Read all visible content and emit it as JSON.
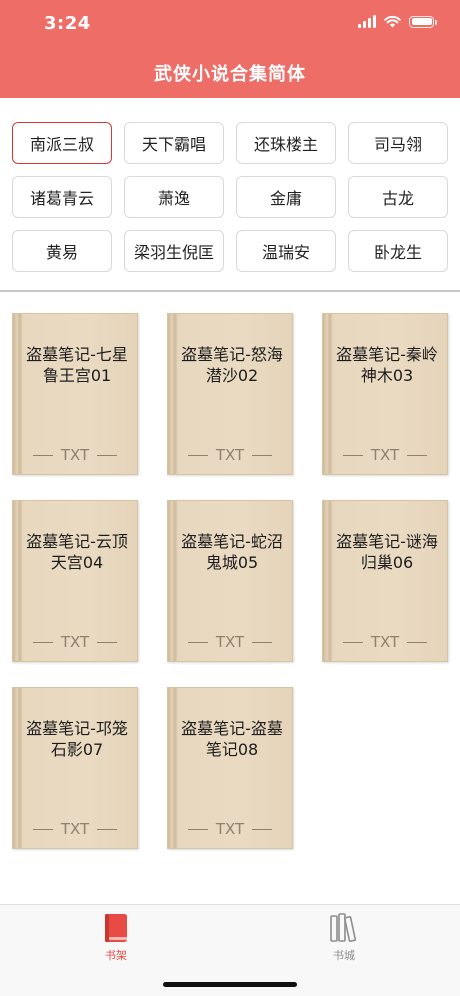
{
  "status_bar": {
    "time": "3:24"
  },
  "header": {
    "title": "武侠小说合集简体"
  },
  "categories": [
    {
      "label": "南派三叔",
      "selected": true
    },
    {
      "label": "天下霸唱"
    },
    {
      "label": "还珠楼主"
    },
    {
      "label": "司马翎"
    },
    {
      "label": "诸葛青云"
    },
    {
      "label": "萧逸"
    },
    {
      "label": "金庸"
    },
    {
      "label": "古龙"
    },
    {
      "label": "黄易"
    },
    {
      "label": "梁羽生倪匡"
    },
    {
      "label": "温瑞安"
    },
    {
      "label": "卧龙生"
    }
  ],
  "books": [
    {
      "title": "盗墓笔记-七星鲁王宫01",
      "format": "TXT"
    },
    {
      "title": "盗墓笔记-怒海潜沙02",
      "format": "TXT"
    },
    {
      "title": "盗墓笔记-秦岭神木03",
      "format": "TXT"
    },
    {
      "title": "盗墓笔记-云顶天宫04",
      "format": "TXT"
    },
    {
      "title": "盗墓笔记-蛇沼鬼城05",
      "format": "TXT"
    },
    {
      "title": "盗墓笔记-谜海归巢06",
      "format": "TXT"
    },
    {
      "title": "盗墓笔记-邛笼石影07",
      "format": "TXT"
    },
    {
      "title": "盗墓笔记-盗墓笔记08",
      "format": "TXT"
    }
  ],
  "tabbar": {
    "bookshelf_label": "书架",
    "store_label": "书城",
    "bookshelf_icon": "book-icon",
    "store_icon": "library-icon",
    "active": "书架"
  },
  "colors": {
    "accent": "#ee6d67",
    "selected_border": "#d93636",
    "active_tab": "#e84a44"
  }
}
